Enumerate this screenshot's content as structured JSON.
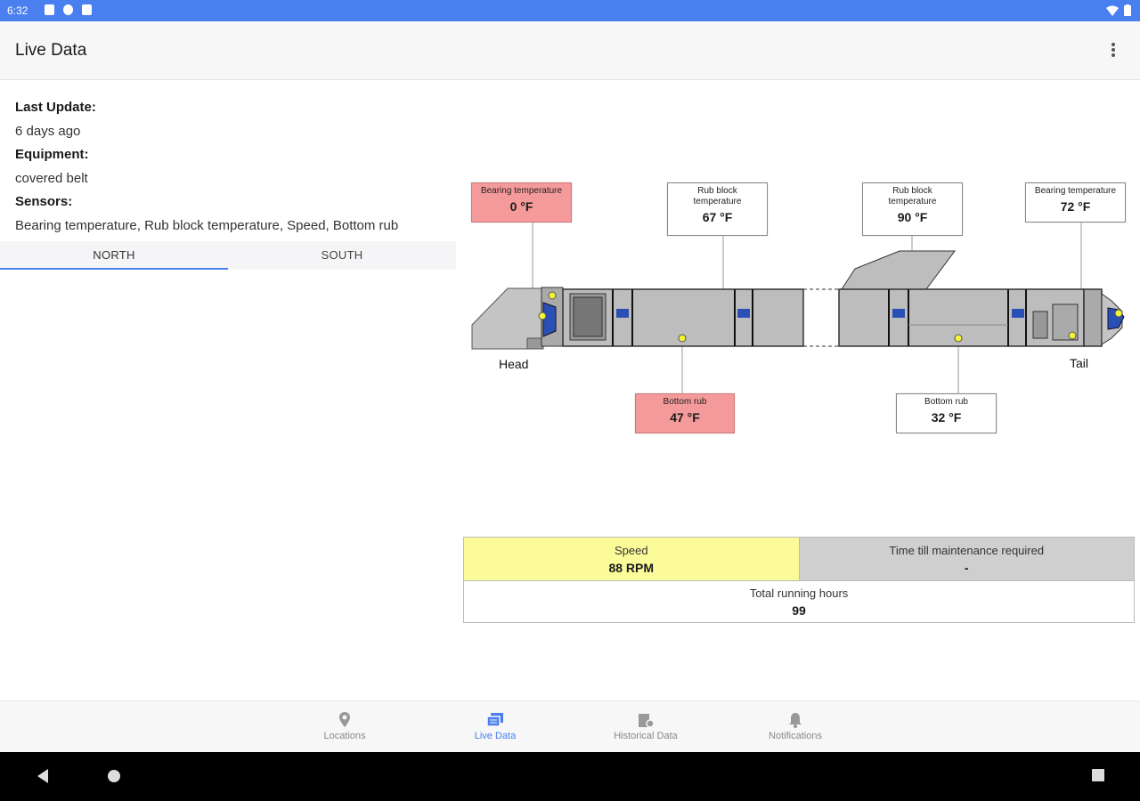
{
  "status_bar": {
    "time": "6:32"
  },
  "app_bar": {
    "title": "Live Data"
  },
  "info": {
    "last_update_label": "Last Update:",
    "last_update_value": "6 days ago",
    "equipment_label": "Equipment:",
    "equipment_value": "covered belt",
    "sensors_label": "Sensors:",
    "sensors_value": "Bearing temperature, Rub block temperature, Speed, Bottom rub"
  },
  "tabs": [
    {
      "label": "NORTH",
      "active": true
    },
    {
      "label": "SOUTH",
      "active": false
    }
  ],
  "diagram": {
    "head_label": "Head",
    "tail_label": "Tail",
    "sensors": [
      {
        "name": "Bearing temperature",
        "value": "0 °F",
        "alarm": true
      },
      {
        "name": "Rub block temperature",
        "value": "67 °F",
        "alarm": false
      },
      {
        "name": "Rub block temperature",
        "value": "90 °F",
        "alarm": false
      },
      {
        "name": "Bearing temperature",
        "value": "72 °F",
        "alarm": false
      },
      {
        "name": "Bottom rub",
        "value": "47 °F",
        "alarm": true
      },
      {
        "name": "Bottom rub",
        "value": "32 °F",
        "alarm": false
      }
    ]
  },
  "cards": {
    "speed_label": "Speed",
    "speed_value": "88 RPM",
    "maintenance_label": "Time till maintenance required",
    "maintenance_value": "-",
    "running_label": "Total running hours",
    "running_value": "99"
  },
  "bottom_nav": [
    {
      "label": "Locations",
      "icon": "location-pin-icon",
      "active": false
    },
    {
      "label": "Live Data",
      "icon": "live-data-icon",
      "active": true
    },
    {
      "label": "Historical Data",
      "icon": "historical-data-icon",
      "active": false
    },
    {
      "label": "Notifications",
      "icon": "bell-icon",
      "active": false
    }
  ],
  "colors": {
    "accent": "#4a7ff0",
    "alarm": "#f59a9a",
    "speed_bg": "#fbfb9a",
    "maintenance_bg": "#cfcfcf"
  }
}
